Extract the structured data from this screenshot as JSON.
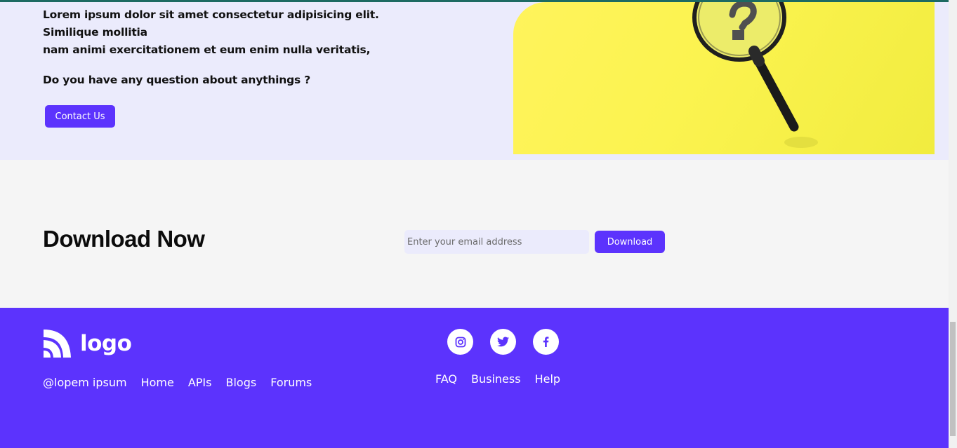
{
  "hero": {
    "text_line1": "Lorem ipsum dolor sit amet consectetur adipisicing elit. Similique mollitia",
    "text_line2": "nam animi exercitationem et eum enim nulla veritatis,",
    "question": "Do you have any question about anythings ?",
    "contact_label": "Contact Us"
  },
  "download": {
    "title": "Download Now",
    "email_placeholder": "Enter your email address",
    "button_label": "Download"
  },
  "footer": {
    "logo_text": "logo",
    "links_left": [
      "@lopem ipsum",
      "Home",
      "APIs",
      "Blogs",
      "Forums"
    ],
    "links_right": [
      "FAQ",
      "Business",
      "Help"
    ],
    "social_icons": [
      "instagram-icon",
      "twitter-icon",
      "facebook-icon"
    ]
  },
  "colors": {
    "accent": "#5c33fd",
    "hero_bg": "#ebebfc",
    "image_bg": "#fbf34f",
    "top_bar": "#1d6a62"
  }
}
